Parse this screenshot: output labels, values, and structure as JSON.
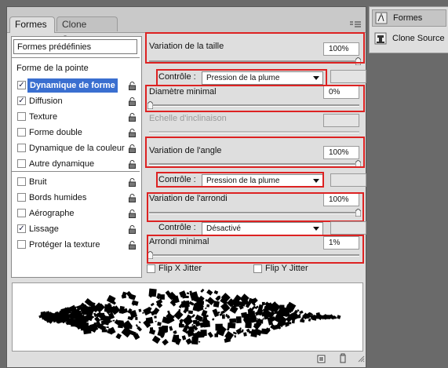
{
  "tabs": [
    {
      "label": "Formes"
    },
    {
      "label": "Clone Source"
    }
  ],
  "left_list": {
    "presets_label": "Formes prédéfinies",
    "tip_shape_label": "Forme de la pointe",
    "items": [
      {
        "label": "Dynamique de forme",
        "checked": true
      },
      {
        "label": "Diffusion",
        "checked": true
      },
      {
        "label": "Texture",
        "checked": false
      },
      {
        "label": "Forme double",
        "checked": false
      },
      {
        "label": "Dynamique de la couleur",
        "checked": false
      },
      {
        "label": "Autre dynamique",
        "checked": false
      },
      {
        "label": "Bruit",
        "checked": false
      },
      {
        "label": "Bords humides",
        "checked": false
      },
      {
        "label": "Aérographe",
        "checked": false
      },
      {
        "label": "Lissage",
        "checked": true
      },
      {
        "label": "Protéger la texture",
        "checked": false
      }
    ]
  },
  "settings": {
    "size_jitter": {
      "label": "Variation de la taille",
      "value": "100%"
    },
    "size_control": {
      "label": "Contrôle :",
      "value": "Pression de la plume"
    },
    "min_diameter": {
      "label": "Diamètre minimal",
      "value": "0%"
    },
    "tilt_scale": {
      "label": "Echelle d'inclinaison"
    },
    "angle_jitter": {
      "label": "Variation de l'angle",
      "value": "100%"
    },
    "angle_control": {
      "label": "Contrôle :",
      "value": "Pression de la plume"
    },
    "roundness_jitter": {
      "label": "Variation de l'arrondi",
      "value": "100%"
    },
    "roundness_control": {
      "label": "Contrôle :",
      "value": "Désactivé"
    },
    "min_roundness": {
      "label": "Arrondi minimal",
      "value": "1%"
    },
    "flip_x": {
      "label": "Flip X Jitter",
      "checked": false
    },
    "flip_y": {
      "label": "Flip Y Jitter",
      "checked": false
    }
  },
  "right_panel": {
    "items": [
      {
        "label": "Formes",
        "icon": "brush-icon"
      },
      {
        "label": "Clone Source",
        "icon": "clone-stamp-icon"
      }
    ]
  },
  "colors": {
    "highlight": "#3a6fd0",
    "annotation_red": "#dd2222",
    "panel_bg": "#dedede"
  }
}
